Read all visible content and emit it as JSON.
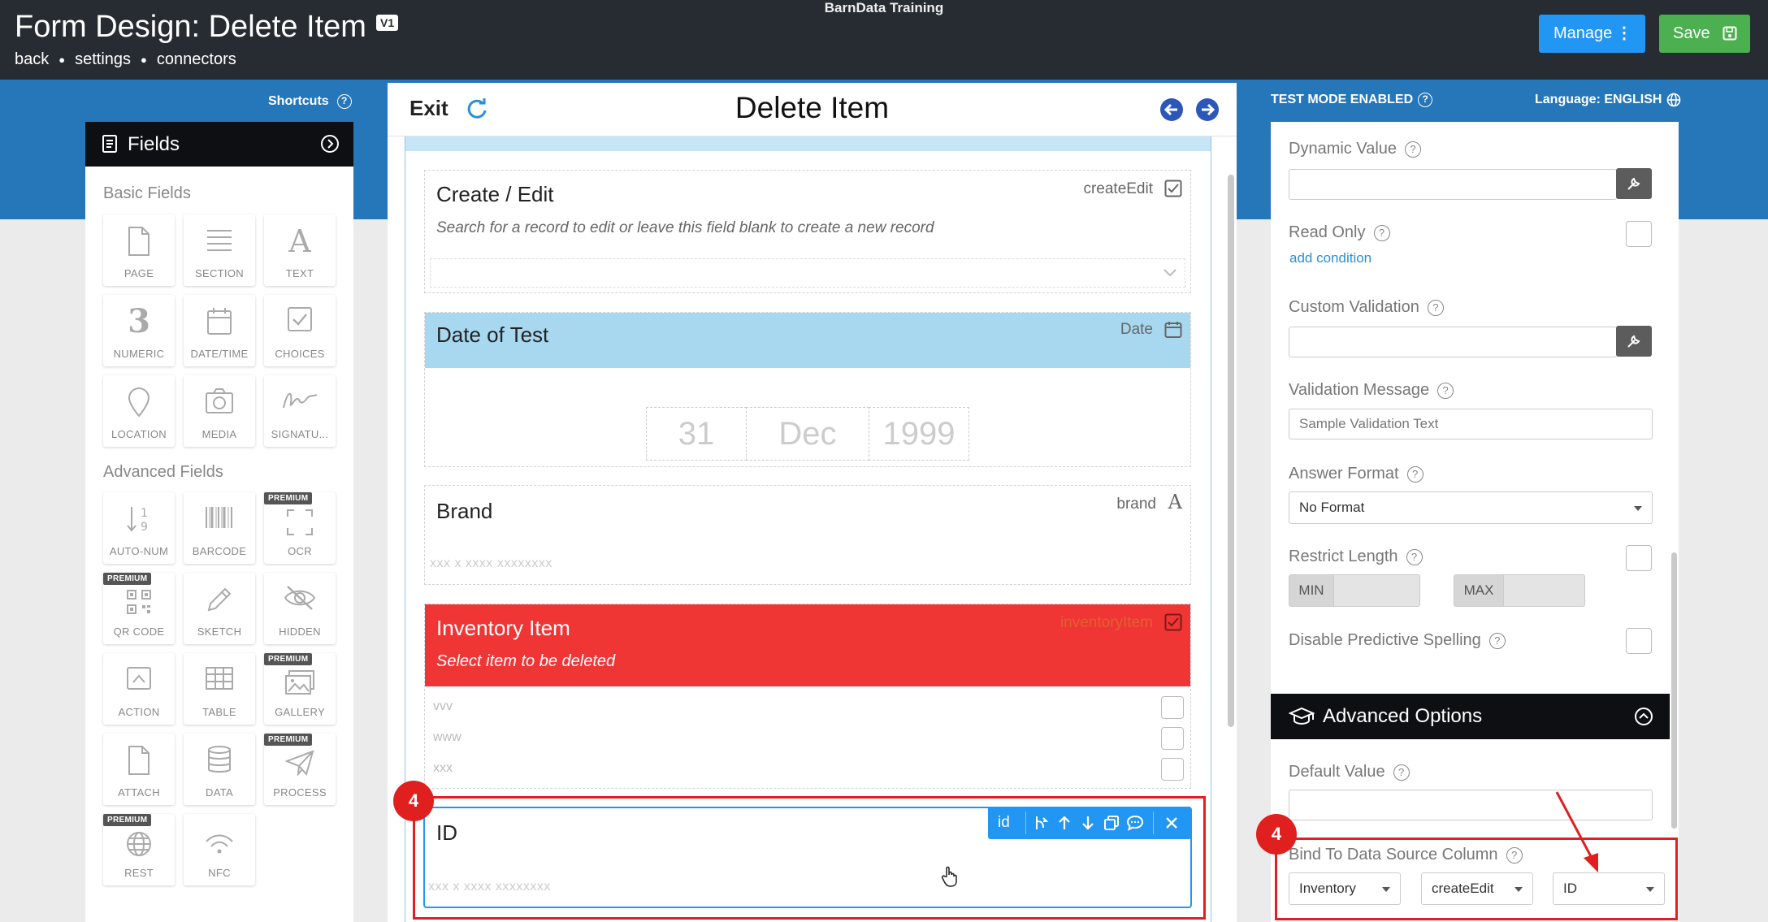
{
  "header": {
    "app_title": "BarnData Training",
    "form_title": "Form Design: Delete Item",
    "version_badge": "V1",
    "nav": [
      "back",
      "settings",
      "connectors"
    ],
    "manage_label": "Manage",
    "save_label": "Save"
  },
  "left_panel": {
    "shortcuts_label": "Shortcuts",
    "fields_title": "Fields",
    "basic_title": "Basic Fields",
    "basic_fields": [
      "PAGE",
      "SECTION",
      "TEXT",
      "NUMERIC",
      "DATE/TIME",
      "CHOICES",
      "LOCATION",
      "MEDIA",
      "SIGNATU..."
    ],
    "numeric_glyph": "3",
    "text_glyph": "A",
    "advanced_title": "Advanced Fields",
    "advanced_fields": [
      "AUTO-NUM",
      "BARCODE",
      "OCR",
      "QR CODE",
      "SKETCH",
      "HIDDEN",
      "ACTION",
      "TABLE",
      "GALLERY",
      "ATTACH",
      "DATA",
      "PROCESS",
      "REST",
      "NFC"
    ],
    "premium_label": "PREMIUM"
  },
  "center": {
    "exit_label": "Exit",
    "title": "Delete Item",
    "create_edit": {
      "label": "Create / Edit",
      "tag": "createEdit",
      "hint": "Search for a record to edit or leave this field blank to create a new record"
    },
    "date_field": {
      "label": "Date of Test",
      "tag": "Date",
      "day": "31",
      "month": "Dec",
      "year": "1999"
    },
    "brand_field": {
      "label": "Brand",
      "tag": "brand",
      "placeholder": "xxx x xxxx xxxxxxxx"
    },
    "inventory_field": {
      "label": "Inventory Item",
      "tag": "inventoryItem",
      "hint": "Select item to be deleted",
      "options": [
        "vvv",
        "www",
        "xxx"
      ],
      "color": "#f03535"
    },
    "id_field": {
      "label": "ID",
      "tag": "id",
      "placeholder": "xxx x xxxx xxxxxxxx"
    },
    "callout_number": "4"
  },
  "right_panel": {
    "test_mode": "TEST MODE ENABLED",
    "language": "Language: ENGLISH",
    "dynamic_value": "Dynamic Value",
    "read_only": "Read Only",
    "add_condition": "add condition",
    "custom_validation": "Custom Validation",
    "validation_message": "Validation Message",
    "validation_placeholder": "Sample Validation Text",
    "answer_format": "Answer Format",
    "answer_format_value": "No Format",
    "restrict_length": "Restrict Length",
    "min_label": "MIN",
    "max_label": "MAX",
    "disable_spelling": "Disable Predictive Spelling",
    "advanced_options": "Advanced Options",
    "default_value": "Default Value",
    "bind_label": "Bind To Data Source Column",
    "bind_values": [
      "Inventory",
      "createEdit",
      "ID"
    ],
    "callout_number": "4"
  },
  "colors": {
    "topbar": "#272c33",
    "brand_blue": "#2676ba",
    "manage": "#2196f3",
    "save": "#4caf50",
    "date_header": "#a8d8f0",
    "id_toolbar": "#2196f3",
    "callout_red": "#e01f1f"
  }
}
